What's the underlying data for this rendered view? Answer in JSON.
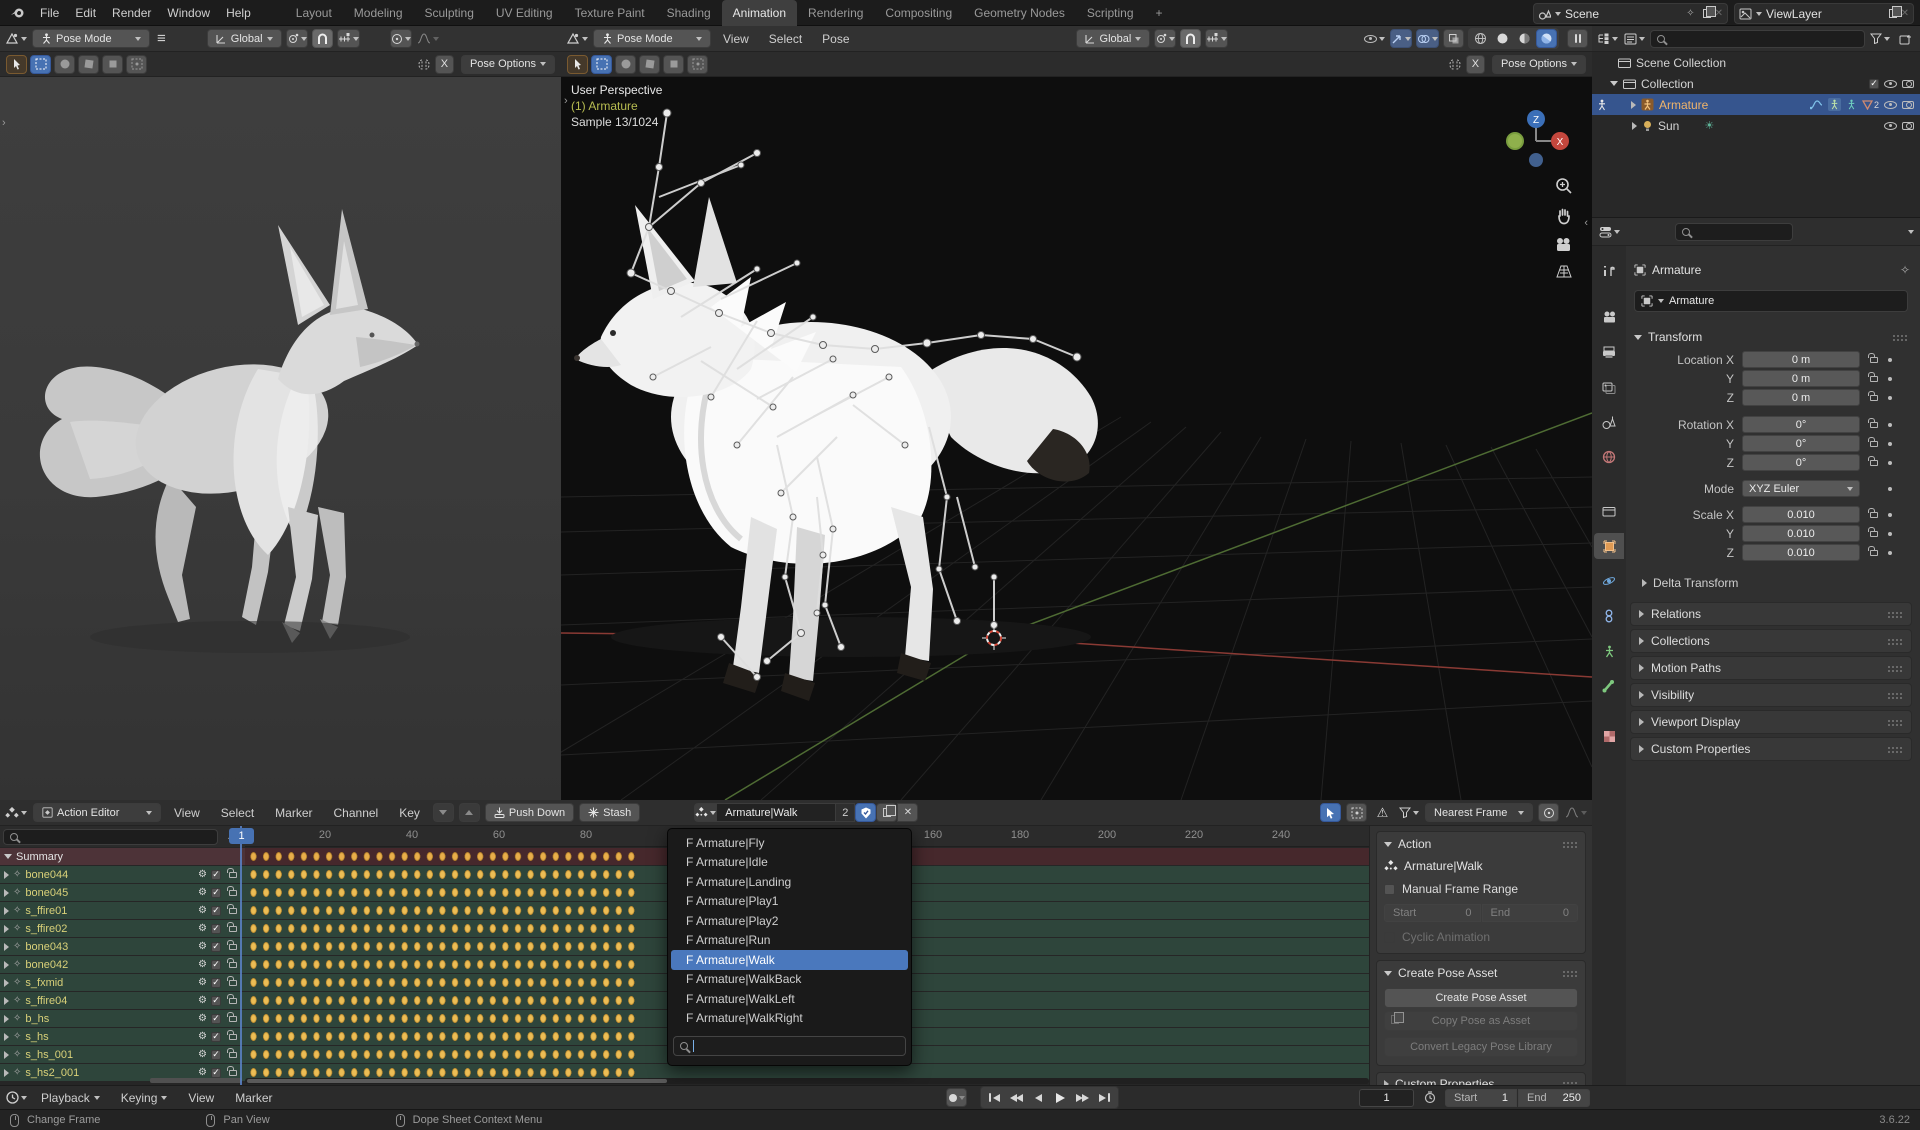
{
  "colors": {
    "accent": "#4772b3",
    "keyframe": "#e0a83a",
    "channel_green": "#2e453b",
    "summary_red": "#4d3338",
    "outliner_select": "#36558e"
  },
  "topbar": {
    "menus": [
      "File",
      "Edit",
      "Render",
      "Window",
      "Help"
    ],
    "tabs": [
      "Layout",
      "Modeling",
      "Sculpting",
      "UV Editing",
      "Texture Paint",
      "Shading",
      "Animation",
      "Rendering",
      "Compositing",
      "Geometry Nodes",
      "Scripting"
    ],
    "add_tab": "+",
    "scene": "Scene",
    "view_layer": "ViewLayer"
  },
  "viewport_left": {
    "mode": "Pose Mode",
    "orientation": "Global",
    "mirror_x": "X",
    "pose_options": "Pose Options"
  },
  "viewport_right": {
    "mode": "Pose Mode",
    "menus": [
      "View",
      "Select",
      "Pose"
    ],
    "orientation": "Global",
    "mirror_x": "X",
    "pose_options": "Pose Options",
    "overlay_perspective": "User Perspective",
    "overlay_object": "(1) Armature",
    "overlay_sample": "Sample 13/1024",
    "axis_x": "X",
    "axis_z": "Z"
  },
  "outliner": {
    "scene_collection": "Scene Collection",
    "collection": "Collection",
    "armature": "Armature",
    "armature_badge": "2",
    "sun": "Sun"
  },
  "properties": {
    "breadcrumb": "Armature",
    "name": "Armature",
    "transform_title": "Transform",
    "location": [
      {
        "label": "Location X",
        "value": "0 m"
      },
      {
        "label": "Y",
        "value": "0 m"
      },
      {
        "label": "Z",
        "value": "0 m"
      }
    ],
    "rotation": [
      {
        "label": "Rotation X",
        "value": "0°"
      },
      {
        "label": "Y",
        "value": "0°"
      },
      {
        "label": "Z",
        "value": "0°"
      }
    ],
    "mode_label": "Mode",
    "mode_value": "XYZ Euler",
    "scale": [
      {
        "label": "Scale X",
        "value": "0.010"
      },
      {
        "label": "Y",
        "value": "0.010"
      },
      {
        "label": "Z",
        "value": "0.010"
      }
    ],
    "delta_transform": "Delta Transform",
    "panels": [
      "Relations",
      "Collections",
      "Motion Paths",
      "Visibility",
      "Viewport Display",
      "Custom Properties"
    ]
  },
  "dopesheet": {
    "editor": "Action Editor",
    "menus": [
      "View",
      "Select",
      "Marker",
      "Channel",
      "Key"
    ],
    "push_down": "Push Down",
    "stash": "Stash",
    "action_name": "Armature|Walk",
    "action_users": "2",
    "snap_mode": "Nearest Frame",
    "playhead_frame": "1",
    "ruler": [
      "20",
      "40",
      "60",
      "80",
      "160",
      "180",
      "200",
      "220",
      "240"
    ],
    "summary": "Summary",
    "channels": [
      "bone044",
      "bone045",
      "s_ffire01",
      "s_ffire02",
      "bone043",
      "bone042",
      "s_fxmid",
      "s_ffire04",
      "b_hs",
      "s_hs",
      "s_hs_001",
      "s_hs2_001"
    ],
    "dropdown": [
      "F Armature|Fly",
      "F Armature|Idle",
      "F Armature|Landing",
      "F Armature|Play1",
      "F Armature|Play2",
      "F Armature|Run",
      "F Armature|Walk",
      "F Armature|WalkBack",
      "F Armature|WalkLeft",
      "F Armature|WalkRight"
    ],
    "sidebar": {
      "action_title": "Action",
      "action_name": "Armature|Walk",
      "manual_frame_range": "Manual Frame Range",
      "start_label": "Start",
      "start_value": "0",
      "end_label": "End",
      "end_value": "0",
      "cyclic": "Cyclic Animation",
      "create_pose_title": "Create Pose Asset",
      "create_pose_btn": "Create Pose Asset",
      "copy_pose_btn": "Copy Pose as Asset",
      "convert_btn": "Convert Legacy Pose Library",
      "custom_properties": "Custom Properties"
    }
  },
  "timeline": {
    "playback": "Playback",
    "keying": "Keying",
    "view": "View",
    "marker": "Marker",
    "frame": "1",
    "start_label": "Start",
    "start_value": "1",
    "end_label": "End",
    "end_value": "250"
  },
  "statusbar": {
    "left": "Change Frame",
    "middle": "Pan View",
    "right": "Dope Sheet Context Menu",
    "version": "3.6.22"
  }
}
